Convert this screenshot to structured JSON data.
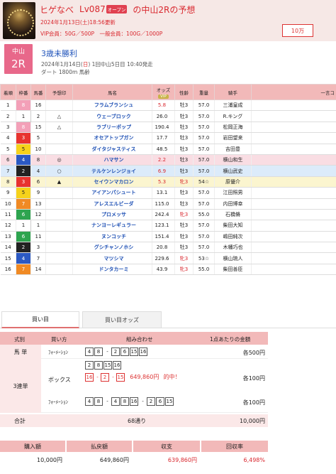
{
  "header": {
    "name": "ヒゲなべ",
    "level": "Lv087",
    "level_badge": "オープン",
    "race_ref": "の中山2R",
    "suffix": "の予想",
    "updated": "2024年1月13日(土)18:56更新",
    "prices": "VIP会員：50G／500P　一般会員：100G／1000P",
    "points_btn": "10万"
  },
  "race": {
    "course": "中山",
    "number": "2R",
    "name": "3歳未勝利",
    "date_prefix": "2024年1月14日(",
    "weekday": "日",
    "date_suffix": ") 1回中山5日目 10:40発走",
    "detail": "ダート 1800m 馬齢"
  },
  "table": {
    "headers": [
      "着順",
      "枠番",
      "馬番",
      "予想印",
      "馬名",
      "オッズ",
      "性齢",
      "重量",
      "騎手",
      "一言コ"
    ],
    "vip_label": "VIP",
    "rows": [
      {
        "rank": "1",
        "waku": "8",
        "uma": "16",
        "mark": "",
        "name": "フラムブランシュ",
        "odds": "5.8",
        "sex": "牡3",
        "wt": "57.0",
        "jockey": "三浦皇成"
      },
      {
        "rank": "2",
        "waku": "1",
        "uma": "2",
        "mark": "△",
        "name": "ウェーブロック",
        "odds": "26.0",
        "sex": "牡3",
        "wt": "57.0",
        "jockey": "R.キング"
      },
      {
        "rank": "3",
        "waku": "8",
        "uma": "15",
        "mark": "△",
        "name": "ラブリーポップ",
        "odds": "190.4",
        "sex": "牡3",
        "wt": "57.0",
        "jockey": "松岡正海"
      },
      {
        "rank": "4",
        "waku": "3",
        "uma": "5",
        "mark": "",
        "name": "オセアトップガン",
        "odds": "17.7",
        "sex": "牡3",
        "wt": "57.0",
        "jockey": "岩田望来"
      },
      {
        "rank": "5",
        "waku": "5",
        "uma": "10",
        "mark": "",
        "name": "ダイタジャスティス",
        "odds": "48.5",
        "sex": "牡3",
        "wt": "57.0",
        "jockey": "吉田豊"
      },
      {
        "rank": "6",
        "waku": "4",
        "uma": "8",
        "mark": "◎",
        "name": "ハマサン",
        "odds": "2.2",
        "sex": "牡3",
        "wt": "57.0",
        "jockey": "横山和生"
      },
      {
        "rank": "7",
        "waku": "2",
        "uma": "4",
        "mark": "○",
        "name": "テルケンレンジョイ",
        "odds": "6.9",
        "sex": "牡3",
        "wt": "57.0",
        "jockey": "横山武史"
      },
      {
        "rank": "8",
        "waku": "3",
        "uma": "6",
        "mark": "▲",
        "name": "セイウンマカロン",
        "odds": "5.3",
        "sex": "牝3",
        "wt": "54☆",
        "jockey": "原優介"
      },
      {
        "rank": "9",
        "waku": "5",
        "uma": "9",
        "mark": "",
        "name": "アイアンパシュート",
        "odds": "13.1",
        "sex": "牡3",
        "wt": "57.0",
        "jockey": "江田照男"
      },
      {
        "rank": "10",
        "waku": "7",
        "uma": "13",
        "mark": "",
        "name": "アレスエルビーダ",
        "odds": "115.0",
        "sex": "牡3",
        "wt": "57.0",
        "jockey": "内田博幸"
      },
      {
        "rank": "11",
        "waku": "6",
        "uma": "12",
        "mark": "",
        "name": "プロメッサ",
        "odds": "242.4",
        "sex": "牝3",
        "wt": "55.0",
        "jockey": "石橋脩"
      },
      {
        "rank": "12",
        "waku": "1",
        "uma": "1",
        "mark": "",
        "name": "ナンヨーレギュラー",
        "odds": "123.1",
        "sex": "牡3",
        "wt": "57.0",
        "jockey": "柴田大知"
      },
      {
        "rank": "13",
        "waku": "6",
        "uma": "11",
        "mark": "",
        "name": "ヌンコッチ",
        "odds": "151.4",
        "sex": "牡3",
        "wt": "57.0",
        "jockey": "嶋田純次"
      },
      {
        "rank": "14",
        "waku": "2",
        "uma": "3",
        "mark": "",
        "name": "グシチャンノホシ",
        "odds": "20.8",
        "sex": "牡3",
        "wt": "57.0",
        "jockey": "木幡巧也"
      },
      {
        "rank": "15",
        "waku": "4",
        "uma": "7",
        "mark": "",
        "name": "マツシマ",
        "odds": "229.6",
        "sex": "牝3",
        "wt": "53☆",
        "jockey": "横山琉人"
      },
      {
        "rank": "16",
        "waku": "7",
        "uma": "14",
        "mark": "",
        "name": "ドンタカーミ",
        "odds": "43.9",
        "sex": "牝3",
        "wt": "55.0",
        "jockey": "柴田善臣"
      }
    ]
  },
  "tabs": {
    "buy": "買い目",
    "odds": "買い目オッズ"
  },
  "bets": {
    "headers": {
      "type": "式別",
      "method": "買い方",
      "combo": "組み合わせ",
      "amount": "1点あたりの金額"
    },
    "umatan": {
      "type": "馬 単",
      "method": "ﾌｫｰﾒｰｼｮﾝ",
      "first": [
        "4",
        "8"
      ],
      "second": [
        "2",
        "6",
        "15",
        "16"
      ],
      "amount": "各500円"
    },
    "sanrentan": {
      "type": "3連単",
      "box_method": "ボックス",
      "box": [
        "2",
        "8",
        "15",
        "16"
      ],
      "box_amount": "各100円",
      "hit": [
        "16",
        "2",
        "15"
      ],
      "hit_payout": "649,860円",
      "hit_label": "的中！",
      "form_method": "ﾌｫｰﾒｰｼｮﾝ",
      "form1": [
        "4",
        "8"
      ],
      "form2": [
        "4",
        "8",
        "16"
      ],
      "form3": [
        "2",
        "6",
        "15"
      ],
      "form_amount": "各100円"
    },
    "total_label": "合計",
    "total_count": "68通り",
    "total_amount": "10,000円"
  },
  "results": {
    "headers": {
      "buy": "購入額",
      "payout": "払戻額",
      "profit": "収支",
      "rate": "回収率"
    },
    "buy": "10,000円",
    "payout": "649,860円",
    "profit": "639,860円",
    "rate": "6,498%"
  },
  "colors": {
    "waku": {
      "1": "#ffffff",
      "2": "#222222",
      "3": "#e8332f",
      "4": "#2b59c3",
      "5": "#f6d21b",
      "6": "#2ea44f",
      "7": "#f08a24",
      "8": "#f3a0b8"
    }
  }
}
